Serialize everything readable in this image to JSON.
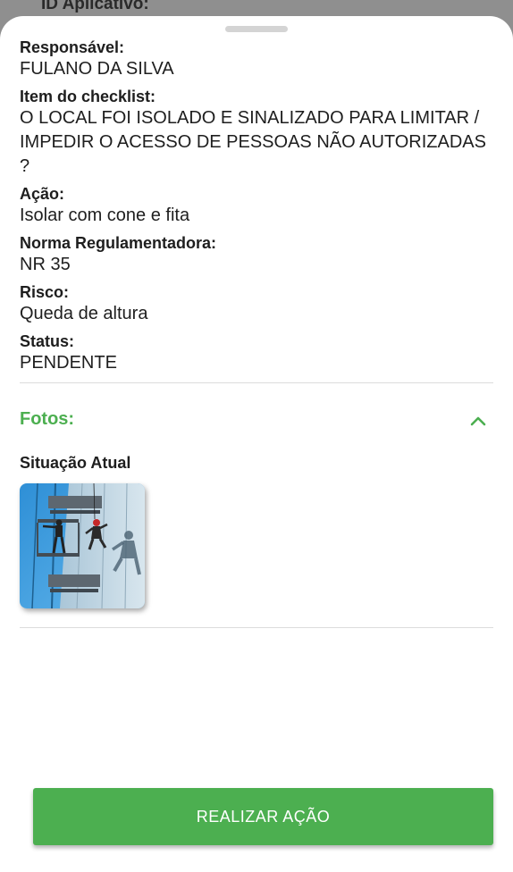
{
  "backdrop": {
    "text": "ID Aplicativo:"
  },
  "details": [
    {
      "label": "Responsável:",
      "value": "FULANO DA SILVA"
    },
    {
      "label": "Item do checklist:",
      "value": "O LOCAL FOI ISOLADO E SINALIZADO PARA LIMITAR / IMPEDIR O ACESSO DE PESSOAS NÃO AUTORIZADAS ?"
    },
    {
      "label": "Ação:",
      "value": "Isolar com cone e fita"
    },
    {
      "label": "Norma Regulamentadora:",
      "value": "NR 35"
    },
    {
      "label": "Risco:",
      "value": "Queda de altura"
    },
    {
      "label": "Status:",
      "value": "PENDENTE"
    }
  ],
  "photos": {
    "title": "Fotos:",
    "expanded": true,
    "icon": "chevron-up-icon",
    "section_label": "Situação Atual",
    "accent_color": "#4caf50"
  },
  "action_button": {
    "label": "REALIZAR AÇÃO",
    "color": "#4caf50"
  }
}
